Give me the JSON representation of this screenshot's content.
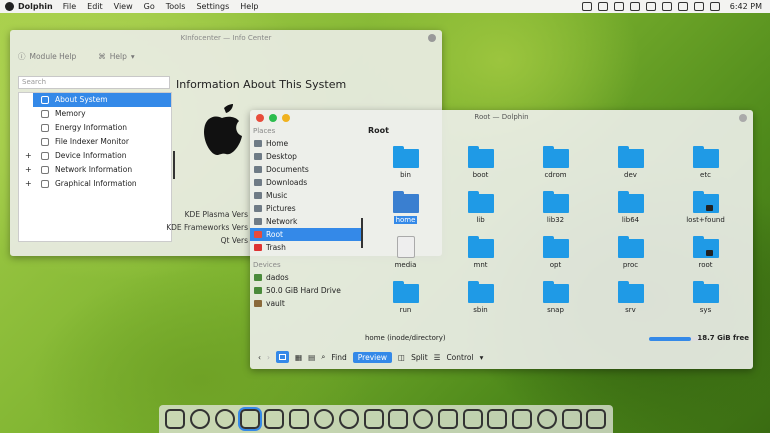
{
  "menubar": {
    "app": "Dolphin",
    "items": [
      "File",
      "Edit",
      "View",
      "Go",
      "Tools",
      "Settings",
      "Help"
    ],
    "time": "6:42 PM"
  },
  "info": {
    "title": "KInfocenter — Info Center",
    "module_help": "Module Help",
    "help": "Help",
    "search_placeholder": "Search",
    "heading": "Information About This System",
    "tree": [
      {
        "label": "About System",
        "selected": true,
        "child": false
      },
      {
        "label": "Memory",
        "child": true
      },
      {
        "label": "Energy Information",
        "child": true
      },
      {
        "label": "File Indexer Monitor",
        "child": true
      },
      {
        "label": "Device Information",
        "expand": "+"
      },
      {
        "label": "Network Information",
        "expand": "+"
      },
      {
        "label": "Graphical Information",
        "expand": "+"
      }
    ],
    "versions": [
      "KDE Plasma Vers",
      "KDE Frameworks Vers",
      "Qt Vers"
    ]
  },
  "dolphin": {
    "title": "Root — Dolphin",
    "places_header": "Places",
    "places": [
      "Home",
      "Desktop",
      "Documents",
      "Downloads",
      "Music",
      "Pictures",
      "Network",
      "Root",
      "Trash"
    ],
    "devices_header": "Devices",
    "devices": [
      "dados",
      "50.0 GiB Hard Drive",
      "vault"
    ],
    "crumb": "Root",
    "folders": [
      "bin",
      "boot",
      "cdrom",
      "dev",
      "etc",
      "home",
      "lib",
      "lib32",
      "lib64",
      "lost+found",
      "media",
      "mnt",
      "opt",
      "proc",
      "root",
      "run",
      "sbin",
      "snap",
      "srv",
      "sys"
    ],
    "status": "home (inode/directory)",
    "free": "18.7 GiB free",
    "toolbar": {
      "find": "Find",
      "preview": "Preview",
      "split": "Split",
      "control": "Control"
    }
  },
  "colors": {
    "accent": "#3489e8",
    "folder": "#1f9ae6",
    "close": "#e84c3c",
    "min": "#2dbd4e",
    "max": "#f0b21f"
  }
}
